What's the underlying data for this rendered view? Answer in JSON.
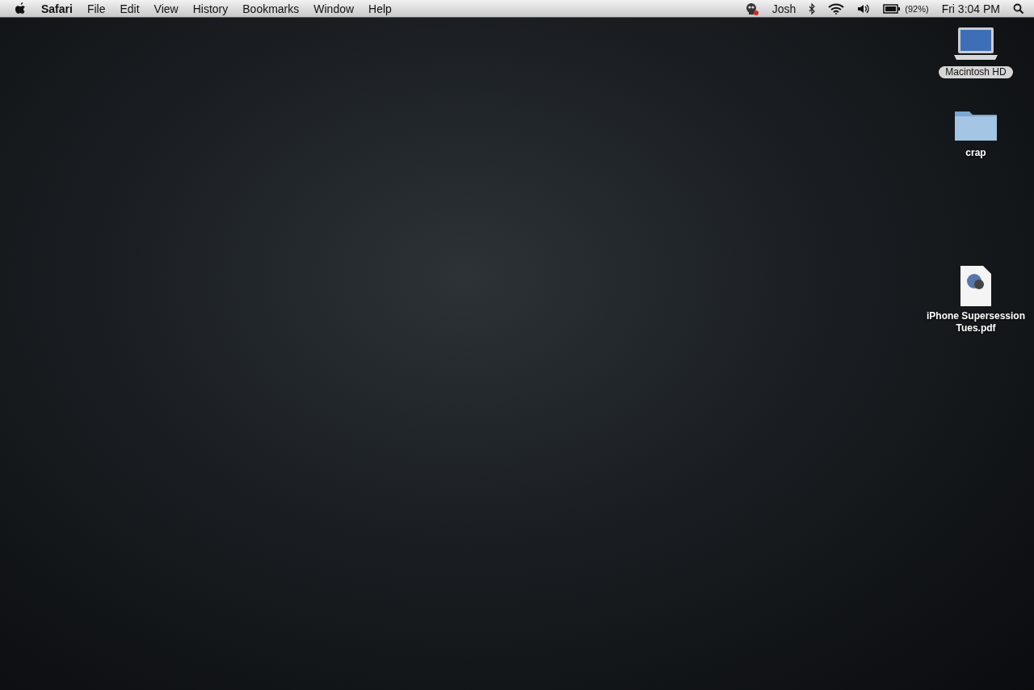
{
  "menu_bar": {
    "app_name": "Safari",
    "menus": [
      "File",
      "Edit",
      "View",
      "History",
      "Bookmarks",
      "Window",
      "Help"
    ],
    "user": "Josh",
    "battery_percent": "(92%)",
    "clock": "Fri 3:04 PM"
  },
  "desktop_icons": [
    {
      "kind": "drive",
      "label": "Macintosh HD",
      "selected": true
    },
    {
      "kind": "folder",
      "label": "crap",
      "selected": false
    },
    {
      "kind": "pdf",
      "label": "iPhone Supersession Tues.pdf",
      "selected": false
    }
  ]
}
